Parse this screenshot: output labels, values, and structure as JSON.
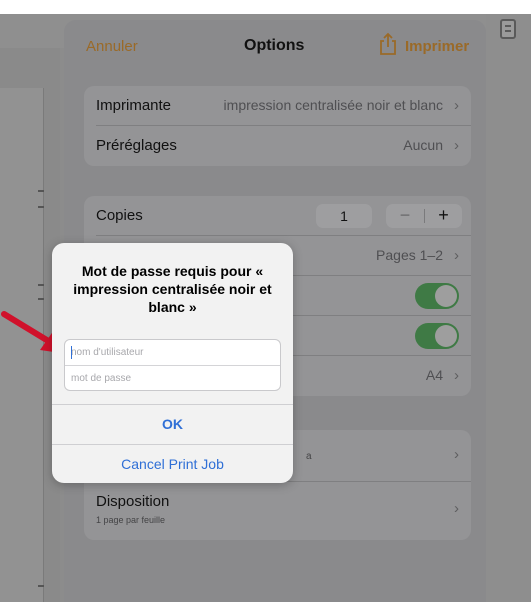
{
  "header": {
    "cancel_label": "Annuler",
    "title": "Options",
    "share_icon": "share-icon",
    "print_label": "Imprimer"
  },
  "printer_group": {
    "printer": {
      "label": "Imprimante",
      "value": "impression centralisée noir et blanc"
    },
    "presets": {
      "label": "Préréglages",
      "value": "Aucun"
    }
  },
  "copies_group": {
    "copies": {
      "label": "Copies",
      "count": "1",
      "minus": "−",
      "plus": "+"
    },
    "range": {
      "value": "Pages 1–2"
    },
    "paper": {
      "value": "A4"
    }
  },
  "layout_group": {
    "disposition": {
      "label": "Disposition",
      "subtitle": "1 page par feuille"
    },
    "partial_subtitle_tail": "a"
  },
  "alert": {
    "title": "Mot de passe requis pour « impression centralisée noir et blanc »",
    "username_placeholder": "nom d'utilisateur",
    "password_placeholder": "mot de passe",
    "ok_label": "OK",
    "cancel_label": "Cancel Print Job"
  },
  "colors": {
    "accent_dimmed": "#9a6a28",
    "alert_button": "#2f6fd6",
    "toggle_on": "#3f7a45",
    "arrow": "#d0112b"
  },
  "chevron": "›"
}
